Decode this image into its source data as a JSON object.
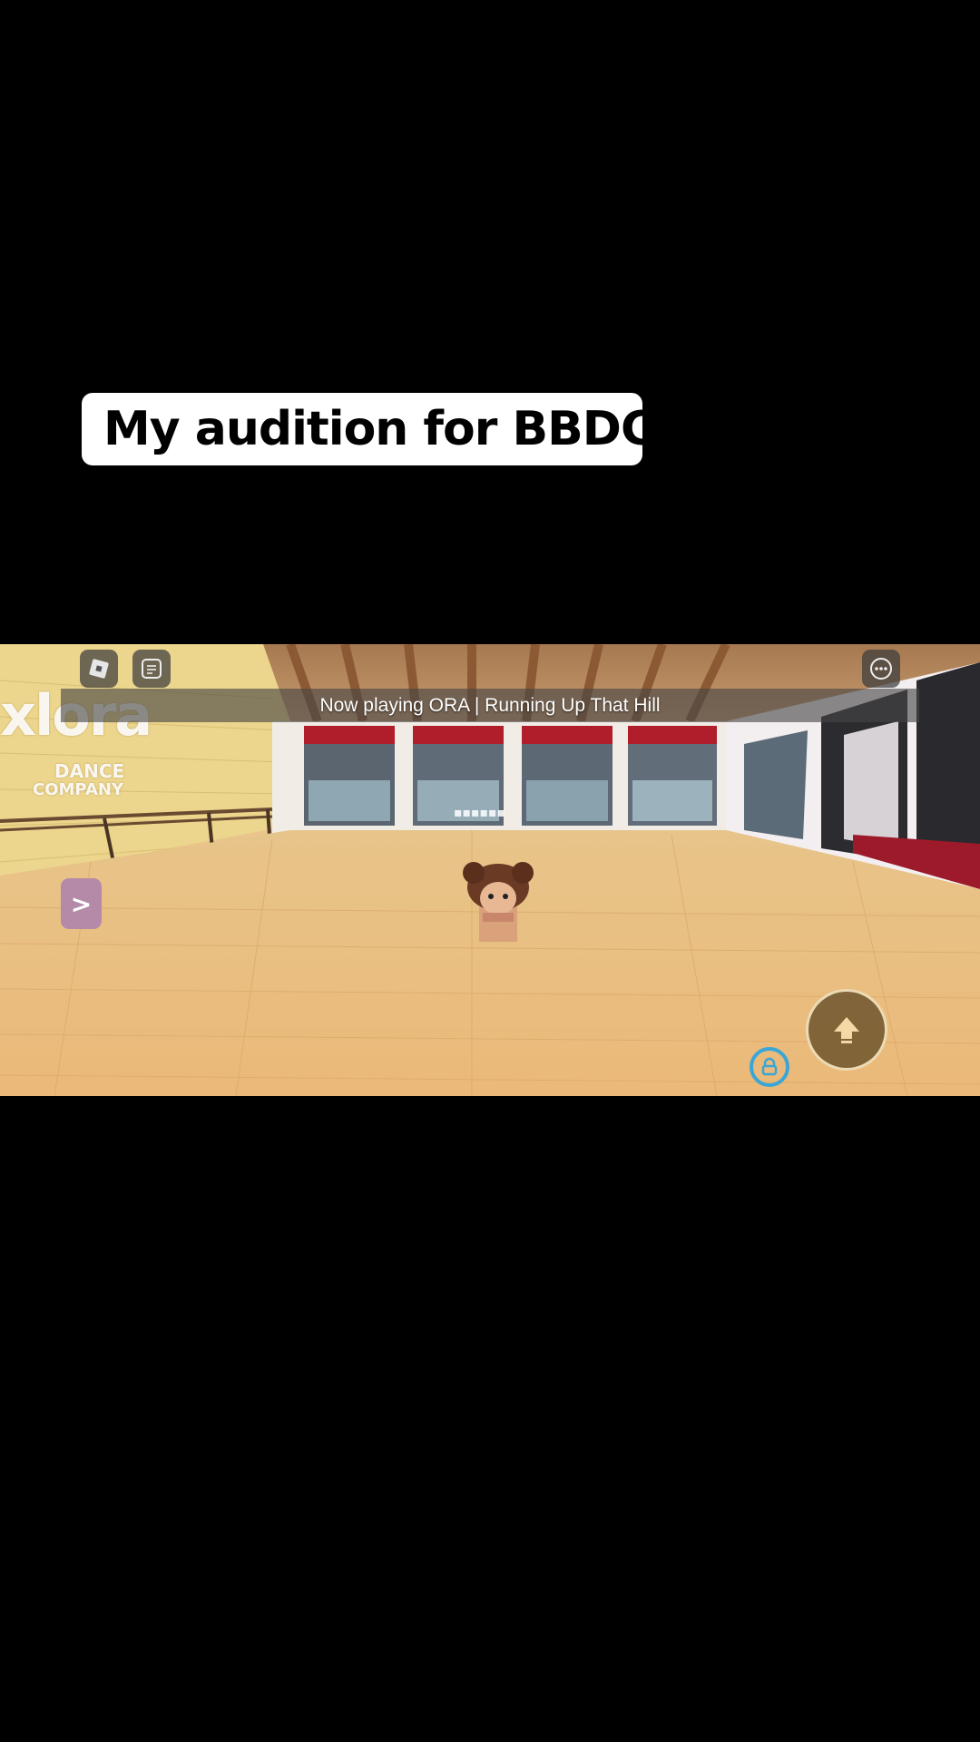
{
  "caption": {
    "text": "My audition for BBDC!"
  },
  "hud": {
    "roblox_menu_icon": "roblox-logo-icon",
    "chat_icon": "chat-icon",
    "more_icon": "more-options-icon",
    "side_toggle_label": ">",
    "jump_icon": "up-arrow-icon",
    "shift_lock_icon": "lock-icon"
  },
  "now_playing": {
    "text": "Now playing ORA | Running Up That Hill"
  },
  "studio": {
    "wall_logo_line1": "xlora",
    "wall_logo_line2": "DANCE",
    "wall_logo_line3": "COMPANY"
  },
  "colors": {
    "floor": "#e8bc7c",
    "wall": "#ecd98f",
    "side_button": "#b58aa8",
    "lock_ring": "#3aa6d8"
  }
}
